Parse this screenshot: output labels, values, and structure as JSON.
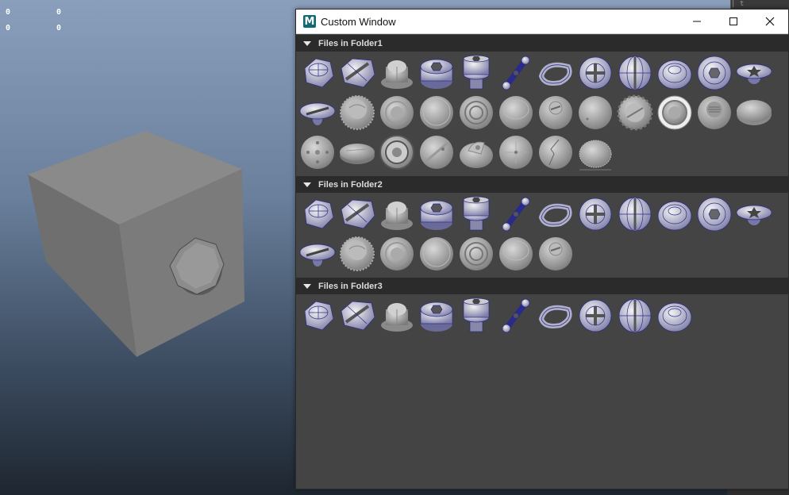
{
  "viewport": {
    "hud": [
      "0",
      "0",
      "0",
      "0"
    ]
  },
  "window": {
    "title": "Custom Window",
    "app_icon_letter": "M",
    "controls": {
      "minimize": "minimize-icon",
      "maximize": "maximize-icon",
      "close": "close-icon"
    }
  },
  "sections": [
    {
      "header": "Files in Folder1",
      "items": [
        "hex-bolt-wire",
        "slotted-hex-screw",
        "hex-cap-nut",
        "hex-socket-head",
        "socket-cap-screw",
        "eye-bolt-chain",
        "triangle-loop",
        "phillips-head",
        "slotted-round-head",
        "round-dome-cap",
        "hex-socket-button",
        "flat-torx-head",
        "oval-slotted-head",
        "serrated-washer",
        "flat-washer-ring",
        "plain-round-cap",
        "double-ring-cap",
        "domed-round-cap",
        "slotted-button",
        "plain-dome-cap",
        "gear-ring-washer",
        "multi-hole-washer",
        "grated-cap",
        "flat-disc",
        "four-dot-disc",
        "thin-flat-disc",
        "complex-ring-cap",
        "cross-slot-disc",
        "tabbed-disc",
        "four-point-disc",
        "cracked-disc",
        "ribbed-dome-cap"
      ]
    },
    {
      "header": "Files in Folder2",
      "items": [
        "hex-bolt-wire",
        "slotted-hex-screw",
        "hex-cap-nut",
        "hex-socket-head",
        "socket-cap-screw",
        "eye-bolt-chain",
        "triangle-loop",
        "phillips-head",
        "slotted-round-head",
        "round-dome-cap",
        "hex-socket-button",
        "flat-torx-head",
        "oval-slotted-head",
        "serrated-washer",
        "flat-washer-ring",
        "plain-round-cap",
        "double-ring-cap",
        "domed-round-cap",
        "slotted-button"
      ]
    },
    {
      "header": "Files in Folder3",
      "items": [
        "hex-bolt-wire",
        "slotted-hex-screw",
        "hex-cap-nut",
        "hex-socket-head",
        "socket-cap-screw",
        "eye-bolt-chain",
        "triangle-loop",
        "phillips-head",
        "slotted-round-head",
        "round-dome-cap"
      ]
    }
  ],
  "colors": {
    "window_bg": "#444444",
    "section_header_bg": "#2b2b2b",
    "wire_blue": "#2a2a8c",
    "mesh_gray": "#9a9a9a"
  }
}
